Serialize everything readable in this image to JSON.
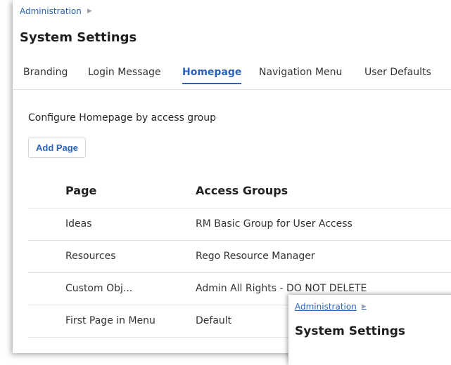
{
  "breadcrumb": {
    "label": "Administration",
    "arrow": "▶"
  },
  "page_title": "System Settings",
  "tabs": [
    {
      "label": "Branding",
      "active": false
    },
    {
      "label": "Login Message",
      "active": false
    },
    {
      "label": "Homepage",
      "active": true
    },
    {
      "label": "Navigation Menu",
      "active": false
    },
    {
      "label": "User Defaults",
      "active": false
    }
  ],
  "description": "Configure Homepage by access group",
  "add_button": "Add Page",
  "table": {
    "headers": [
      "Page",
      "Access Groups"
    ],
    "rows": [
      {
        "page": "Ideas",
        "groups": "RM Basic Group for User Access"
      },
      {
        "page": "Resources",
        "groups": "Rego Resource Manager"
      },
      {
        "page": "Custom Obj...",
        "groups": "Admin All Rights - DO NOT DELETE"
      },
      {
        "page": "First Page in Menu",
        "groups": "Default"
      }
    ]
  },
  "overlay": {
    "breadcrumb": "Administration",
    "arrow": "▶",
    "title": "System Settings"
  },
  "colors": {
    "accent": "#2a63b8",
    "divider": "#e1e4e8"
  }
}
